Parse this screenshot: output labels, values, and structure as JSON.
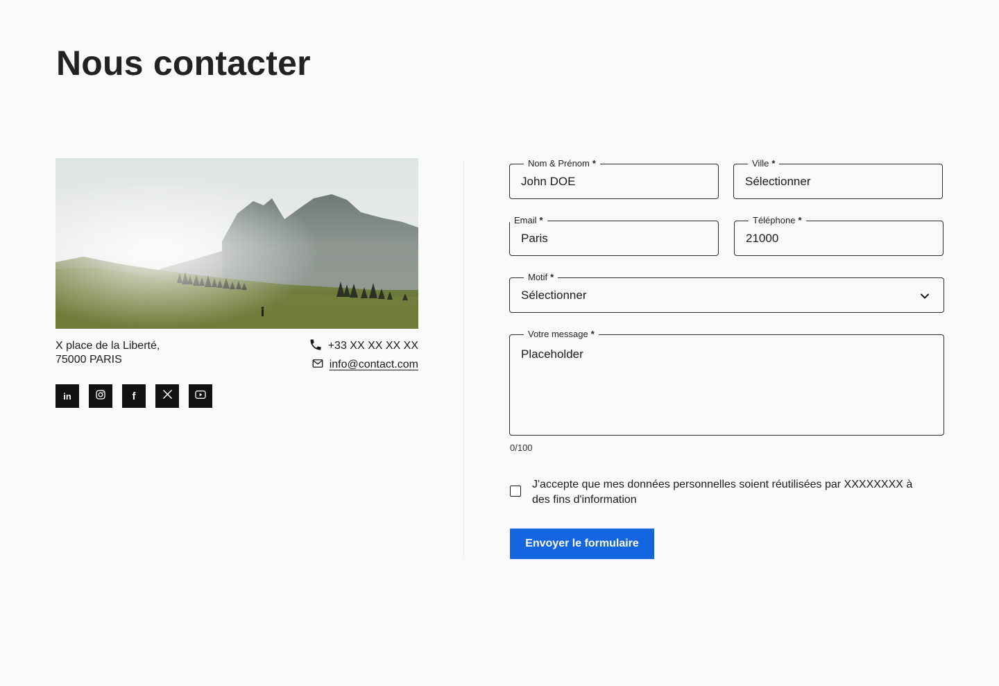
{
  "page": {
    "title": "Nous contacter"
  },
  "location": {
    "address_line1": "X place de la Liberté,",
    "address_line2": "75000 PARIS",
    "phone": "+33 XX XX XX XX",
    "email": "info@contact.com"
  },
  "socials": [
    {
      "name": "linkedin-icon",
      "glyph": "in"
    },
    {
      "name": "instagram-icon"
    },
    {
      "name": "facebook-icon",
      "glyph": "f"
    },
    {
      "name": "x-icon",
      "glyph": "𝕏"
    },
    {
      "name": "youtube-icon"
    }
  ],
  "form": {
    "name": {
      "label": "Nom & Prénom",
      "value": "John DOE"
    },
    "city": {
      "label": "Ville",
      "value": "Sélectionner"
    },
    "email": {
      "label": "Email",
      "value": "Paris"
    },
    "phone": {
      "label": "Téléphone",
      "value": "21000"
    },
    "reason": {
      "label": "Motif",
      "value": "Sélectionner"
    },
    "message": {
      "label": "Votre message",
      "placeholder": "Placeholder"
    },
    "required_marker": "*",
    "counter": "0/100",
    "consent": "J'accepte que mes données personnelles soient réutilisées par XXXXXXXX à des fins d'information",
    "submit_label": "Envoyer le formulaire"
  },
  "colors": {
    "accent": "#1466e0",
    "social_bg": "#111111",
    "background": "#fafafa"
  }
}
